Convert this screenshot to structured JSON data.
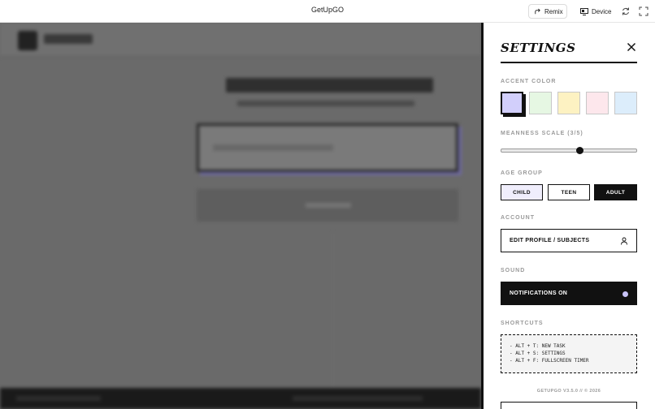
{
  "topbar": {
    "title": "GetUpGO",
    "remix_label": "Remix",
    "device_label": "Device"
  },
  "settings": {
    "title": "SETTINGS",
    "accent_label": "ACCENT COLOR",
    "accent_colors": [
      "#d2cffb",
      "#e6f7e3",
      "#fdf2c2",
      "#fde7ec",
      "#dcedfb"
    ],
    "accent_selected_index": 0,
    "meanness_label": "MEANNESS SCALE (3/5)",
    "meanness_value": 3,
    "meanness_max": 5,
    "age_label": "AGE GROUP",
    "age_options": [
      "CHILD",
      "TEEN",
      "ADULT"
    ],
    "age_selected": "ADULT",
    "account_label": "ACCOUNT",
    "account_button": "EDIT PROFILE / SUBJECTS",
    "sound_label": "SOUND",
    "sound_button": "NOTIFICATIONS ON",
    "sound_indicator_color": "#c9c4f8",
    "shortcuts_label": "SHORTCUTS",
    "shortcuts": [
      "- ALT + T: NEW TASK",
      "- ALT + S: SETTINGS",
      "- ALT + F: FULLSCREEN TIMER"
    ],
    "version": "GETUPGO V3.5.0 // © 2026"
  }
}
